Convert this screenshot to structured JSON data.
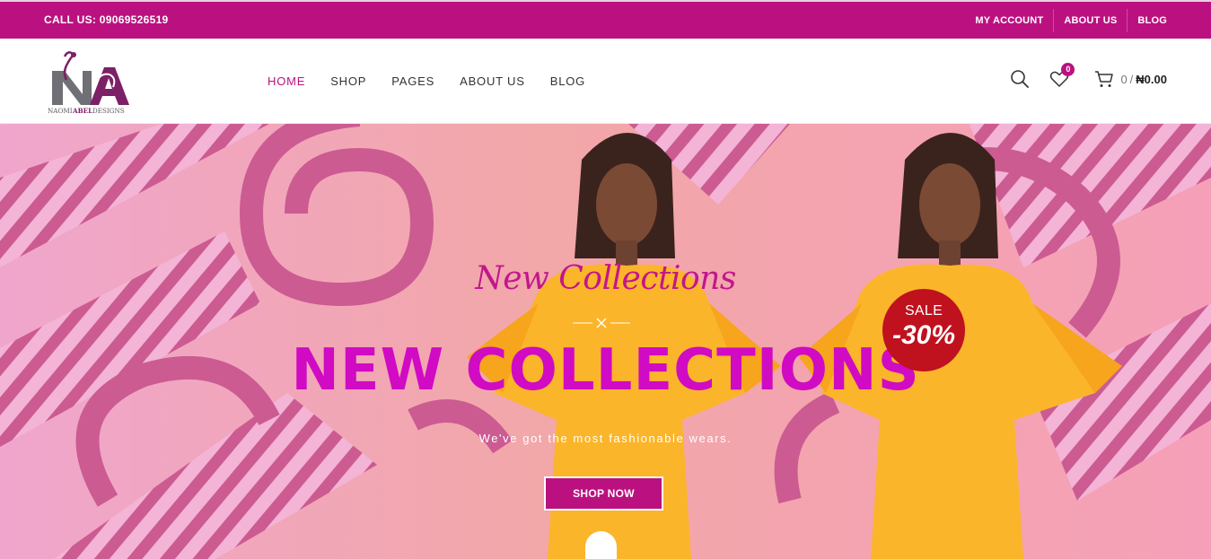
{
  "topbar": {
    "call": "CALL US: 09069526519",
    "links": [
      "MY ACCOUNT",
      "ABOUT US",
      "BLOG"
    ]
  },
  "logo": {
    "monogram": "NA",
    "brand_first": "NAOMI",
    "brand_second": "ABEL",
    "brand_third": "DESIGNS"
  },
  "nav": {
    "items": [
      "HOME",
      "SHOP",
      "PAGES",
      "ABOUT US",
      "BLOG"
    ],
    "active": "HOME"
  },
  "tools": {
    "search_icon": "search-icon",
    "wishlist_icon": "heart-icon",
    "wishlist_count": "0",
    "cart_icon": "cart-icon",
    "cart_count": "0",
    "cart_sep": "/",
    "cart_total": "₦0.00"
  },
  "hero": {
    "subheading": "New Collections",
    "heading": "NEW COLLECTIONS",
    "tagline": "We've got the most fashionable wears.",
    "cta": "SHOP NOW",
    "sale_label": "SALE",
    "sale_value": "-30%"
  },
  "colors": {
    "brand": "#bb1180",
    "heading": "#d10ac3",
    "sale": "#c0111f"
  }
}
